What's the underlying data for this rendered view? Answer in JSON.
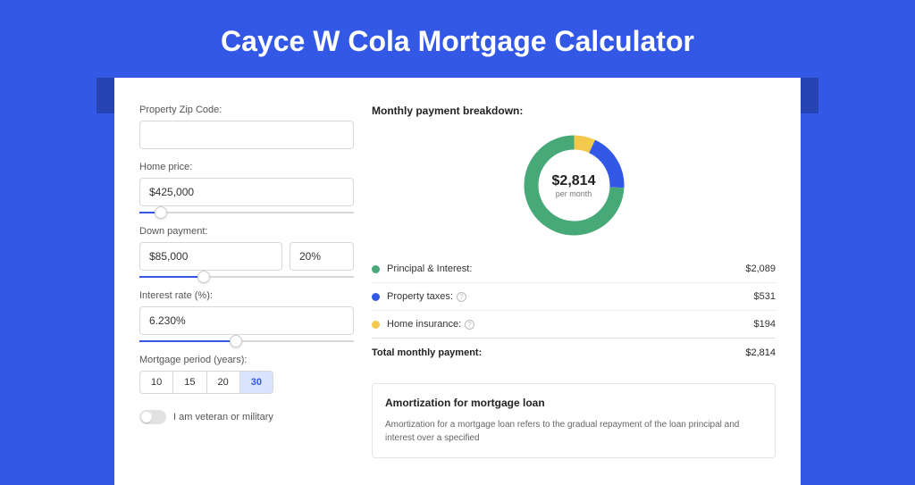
{
  "title": "Cayce W Cola Mortgage Calculator",
  "form": {
    "zip_label": "Property Zip Code:",
    "zip_value": "",
    "home_price_label": "Home price:",
    "home_price_value": "$425,000",
    "home_price_slider_pct": 10,
    "down_payment_label": "Down payment:",
    "down_payment_value": "$85,000",
    "down_payment_pct_value": "20%",
    "down_payment_slider_pct": 30,
    "interest_label": "Interest rate (%):",
    "interest_value": "6.230%",
    "interest_slider_pct": 45,
    "period_label": "Mortgage period (years):",
    "periods": [
      "10",
      "15",
      "20",
      "30"
    ],
    "period_active": "30",
    "veteran_label": "I am veteran or military"
  },
  "breakdown": {
    "title": "Monthly payment breakdown:",
    "total_value": "$2,814",
    "total_sub": "per month",
    "items": [
      {
        "label": "Principal & Interest:",
        "amount": "$2,089",
        "color": "#47a878",
        "has_info": false
      },
      {
        "label": "Property taxes:",
        "amount": "$531",
        "color": "#3358e6",
        "has_info": true
      },
      {
        "label": "Home insurance:",
        "amount": "$194",
        "color": "#f2c94c",
        "has_info": true
      }
    ],
    "total_label": "Total monthly payment:",
    "total_amount": "$2,814"
  },
  "chart_data": {
    "type": "pie",
    "title": "Monthly payment breakdown",
    "series": [
      {
        "name": "Principal & Interest",
        "value": 2089,
        "color": "#47a878"
      },
      {
        "name": "Property taxes",
        "value": 531,
        "color": "#3358e6"
      },
      {
        "name": "Home insurance",
        "value": 194,
        "color": "#f2c94c"
      }
    ],
    "total": 2814,
    "center_label": "$2,814",
    "center_sub": "per month"
  },
  "amortization": {
    "title": "Amortization for mortgage loan",
    "text": "Amortization for a mortgage loan refers to the gradual repayment of the loan principal and interest over a specified"
  }
}
